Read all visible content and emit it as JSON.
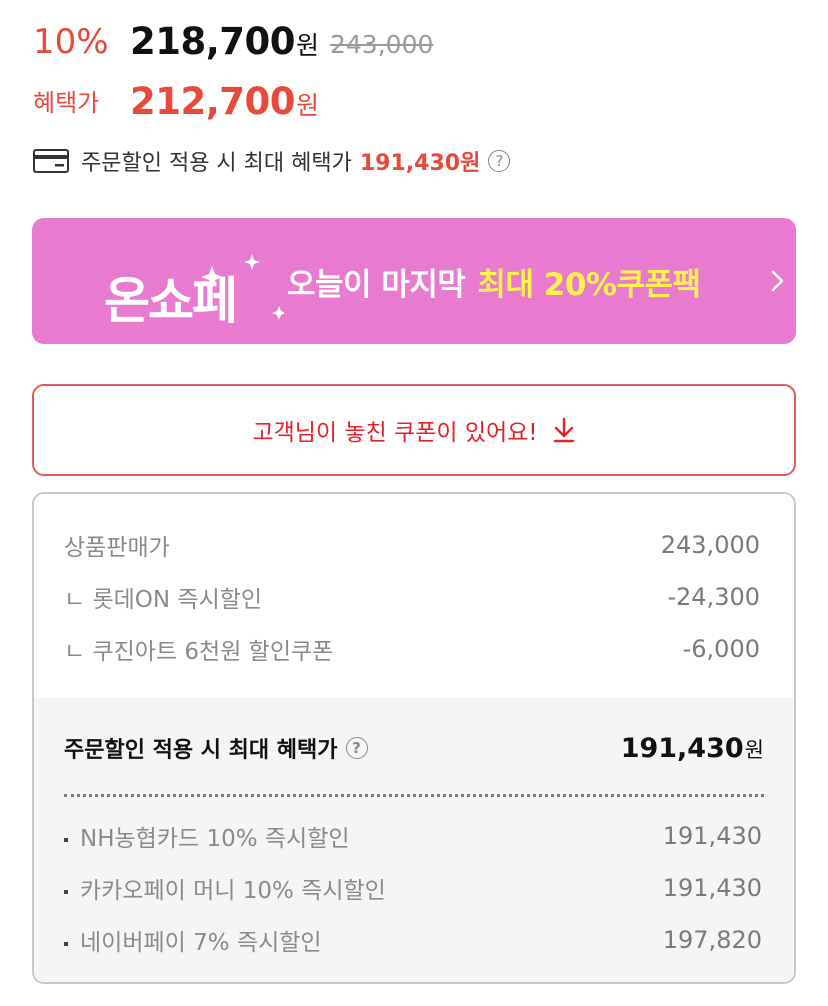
{
  "price": {
    "discount_rate": "10%",
    "sale_price": "218,700",
    "sale_price_unit": "원",
    "original_price": "243,000",
    "benefit_label": "혜택가",
    "benefit_price": "212,700",
    "benefit_price_unit": "원"
  },
  "max_benefit": {
    "label": "주문할인 적용 시 최대 혜택가",
    "value": "191,430원",
    "help": "?"
  },
  "banner": {
    "logo_text": "온쇼페",
    "text": "오늘이 마지막",
    "highlight": "최대 20%쿠폰팩",
    "background": "#e87ad0",
    "highlight_color": "#fff24a"
  },
  "coupon_button": {
    "label": "고객님이 놓친 쿠폰이 있어요!"
  },
  "breakdown": {
    "rows": [
      {
        "label": "상품판매가",
        "value": "243,000"
      },
      {
        "label": "ㄴ 롯데ON 즉시할인",
        "value": "-24,300"
      },
      {
        "label": "ㄴ 쿠진아트 6천원 할인쿠폰",
        "value": "-6,000"
      }
    ],
    "total_label": "주문할인 적용 시 최대 혜택가",
    "total_help": "?",
    "total_value": "191,430",
    "total_unit": "원",
    "payments": [
      {
        "label": "NH농협카드 10% 즉시할인",
        "value": "191,430"
      },
      {
        "label": "카카오페이 머니 10% 즉시할인",
        "value": "191,430"
      },
      {
        "label": "네이버페이 7% 즉시할인",
        "value": "197,820"
      }
    ]
  },
  "colors": {
    "accent_red": "#e8493a",
    "coupon_red": "#e0242a"
  }
}
